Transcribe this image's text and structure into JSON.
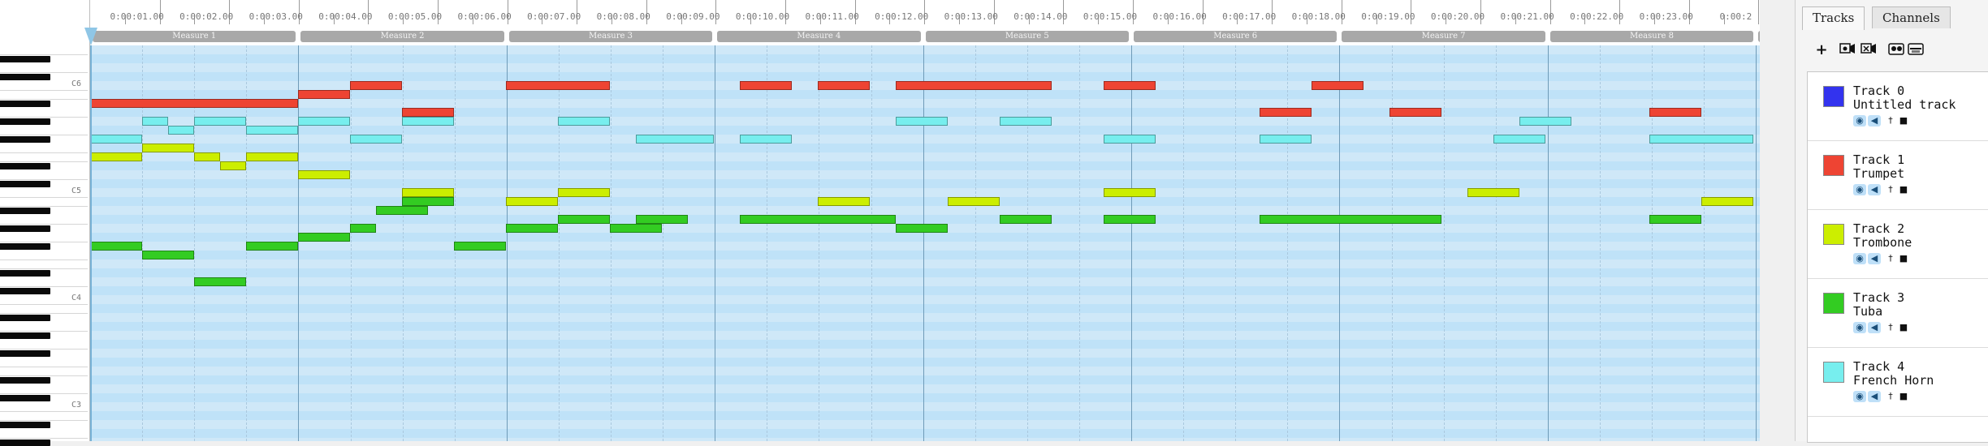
{
  "ruler": {
    "time_labels": [
      "0:00:01.00",
      "0:00:02.00",
      "0:00:03.00",
      "0:00:04.00",
      "0:00:05.00",
      "0:00:06.00",
      "0:00:07.00",
      "0:00:08.00",
      "0:00:09.00",
      "0:00:10.00",
      "0:00:11.00",
      "0:00:12.00",
      "0:00:13.00",
      "0:00:14.00",
      "0:00:15.00",
      "0:00:16.00",
      "0:00:17.00",
      "0:00:18.00",
      "0:00:19.00",
      "0:00:20.00",
      "0:00:21.00",
      "0:00:22.00",
      "0:00:23.00",
      "0:00:2"
    ],
    "measures": [
      "Measure 1",
      "Measure 2",
      "Measure 3",
      "Measure 4",
      "Measure 5",
      "Measure 6",
      "Measure 7",
      "Measure 8"
    ]
  },
  "piano": {
    "octave_labels": [
      "C6",
      "C5",
      "C4",
      "C3"
    ]
  },
  "roll": {
    "notes": [
      {
        "track": 1,
        "pitch": 82,
        "start": 0,
        "len": 16
      },
      {
        "track": 1,
        "pitch": 83,
        "start": 16,
        "len": 4
      },
      {
        "track": 1,
        "pitch": 84,
        "start": 20,
        "len": 4
      },
      {
        "track": 1,
        "pitch": 81,
        "start": 24,
        "len": 4
      },
      {
        "track": 1,
        "pitch": 84,
        "start": 32,
        "len": 8
      },
      {
        "track": 1,
        "pitch": 84,
        "start": 50,
        "len": 4
      },
      {
        "track": 1,
        "pitch": 84,
        "start": 56,
        "len": 4
      },
      {
        "track": 1,
        "pitch": 84,
        "start": 62,
        "len": 12
      },
      {
        "track": 1,
        "pitch": 84,
        "start": 78,
        "len": 4
      },
      {
        "track": 1,
        "pitch": 81,
        "start": 90,
        "len": 4
      },
      {
        "track": 1,
        "pitch": 84,
        "start": 94,
        "len": 4
      },
      {
        "track": 1,
        "pitch": 81,
        "start": 100,
        "len": 4
      },
      {
        "track": 1,
        "pitch": 81,
        "start": 120,
        "len": 4
      },
      {
        "track": 4,
        "pitch": 78,
        "start": 0,
        "len": 4
      },
      {
        "track": 4,
        "pitch": 80,
        "start": 4,
        "len": 2
      },
      {
        "track": 4,
        "pitch": 79,
        "start": 6,
        "len": 2
      },
      {
        "track": 4,
        "pitch": 80,
        "start": 8,
        "len": 4
      },
      {
        "track": 4,
        "pitch": 79,
        "start": 12,
        "len": 4
      },
      {
        "track": 4,
        "pitch": 80,
        "start": 16,
        "len": 4
      },
      {
        "track": 4,
        "pitch": 78,
        "start": 20,
        "len": 4
      },
      {
        "track": 4,
        "pitch": 80,
        "start": 24,
        "len": 4
      },
      {
        "track": 4,
        "pitch": 80,
        "start": 36,
        "len": 4
      },
      {
        "track": 4,
        "pitch": 78,
        "start": 42,
        "len": 6
      },
      {
        "track": 4,
        "pitch": 78,
        "start": 50,
        "len": 4
      },
      {
        "track": 4,
        "pitch": 80,
        "start": 62,
        "len": 4
      },
      {
        "track": 4,
        "pitch": 80,
        "start": 70,
        "len": 4
      },
      {
        "track": 4,
        "pitch": 78,
        "start": 78,
        "len": 4
      },
      {
        "track": 4,
        "pitch": 78,
        "start": 90,
        "len": 4
      },
      {
        "track": 4,
        "pitch": 78,
        "start": 108,
        "len": 4
      },
      {
        "track": 4,
        "pitch": 80,
        "start": 110,
        "len": 4
      },
      {
        "track": 4,
        "pitch": 78,
        "start": 120,
        "len": 8
      },
      {
        "track": 2,
        "pitch": 77,
        "start": 4,
        "len": 4
      },
      {
        "track": 2,
        "pitch": 76,
        "start": 0,
        "len": 4
      },
      {
        "track": 2,
        "pitch": 76,
        "start": 8,
        "len": 2
      },
      {
        "track": 2,
        "pitch": 75,
        "start": 10,
        "len": 2
      },
      {
        "track": 2,
        "pitch": 76,
        "start": 12,
        "len": 4
      },
      {
        "track": 2,
        "pitch": 74,
        "start": 16,
        "len": 4
      },
      {
        "track": 2,
        "pitch": 72,
        "start": 24,
        "len": 4
      },
      {
        "track": 2,
        "pitch": 71,
        "start": 32,
        "len": 4
      },
      {
        "track": 2,
        "pitch": 72,
        "start": 36,
        "len": 4
      },
      {
        "track": 2,
        "pitch": 71,
        "start": 56,
        "len": 4
      },
      {
        "track": 2,
        "pitch": 71,
        "start": 66,
        "len": 4
      },
      {
        "track": 2,
        "pitch": 72,
        "start": 78,
        "len": 4
      },
      {
        "track": 2,
        "pitch": 72,
        "start": 106,
        "len": 4
      },
      {
        "track": 2,
        "pitch": 71,
        "start": 124,
        "len": 4
      },
      {
        "track": 3,
        "pitch": 71,
        "start": 24,
        "len": 4
      },
      {
        "track": 3,
        "pitch": 70,
        "start": 22,
        "len": 4
      },
      {
        "track": 3,
        "pitch": 68,
        "start": 20,
        "len": 2
      },
      {
        "track": 3,
        "pitch": 67,
        "start": 16,
        "len": 4
      },
      {
        "track": 3,
        "pitch": 66,
        "start": 0,
        "len": 4
      },
      {
        "track": 3,
        "pitch": 65,
        "start": 4,
        "len": 4
      },
      {
        "track": 3,
        "pitch": 66,
        "start": 12,
        "len": 4
      },
      {
        "track": 3,
        "pitch": 62,
        "start": 8,
        "len": 4
      },
      {
        "track": 3,
        "pitch": 66,
        "start": 28,
        "len": 4
      },
      {
        "track": 3,
        "pitch": 68,
        "start": 32,
        "len": 4
      },
      {
        "track": 3,
        "pitch": 69,
        "start": 36,
        "len": 4
      },
      {
        "track": 3,
        "pitch": 68,
        "start": 40,
        "len": 4
      },
      {
        "track": 3,
        "pitch": 69,
        "start": 42,
        "len": 4
      },
      {
        "track": 3,
        "pitch": 69,
        "start": 50,
        "len": 12
      },
      {
        "track": 3,
        "pitch": 68,
        "start": 62,
        "len": 4
      },
      {
        "track": 3,
        "pitch": 69,
        "start": 70,
        "len": 4
      },
      {
        "track": 3,
        "pitch": 69,
        "start": 78,
        "len": 4
      },
      {
        "track": 3,
        "pitch": 69,
        "start": 90,
        "len": 14
      },
      {
        "track": 3,
        "pitch": 69,
        "start": 120,
        "len": 4
      }
    ]
  },
  "panel": {
    "tabs": [
      "Tracks",
      "Channels"
    ],
    "toolbar": {
      "add": "+"
    },
    "tracks": [
      {
        "name": "Track 0",
        "instrument": "Untitled track",
        "color": "#3333ee"
      },
      {
        "name": "Track 1",
        "instrument": "Trumpet",
        "color": "#ee4433"
      },
      {
        "name": "Track 2",
        "instrument": "Trombone",
        "color": "#ccee00"
      },
      {
        "name": "Track 3",
        "instrument": "Tuba",
        "color": "#33cc22"
      },
      {
        "name": "Track 4",
        "instrument": "French Horn",
        "color": "#77eeee"
      }
    ]
  },
  "colors": {
    "grid_light": "#cfe8f8",
    "grid_dark": "#bfe2f8",
    "measure_bar": "#a8a8a8",
    "accent": "#8fc6e6"
  }
}
